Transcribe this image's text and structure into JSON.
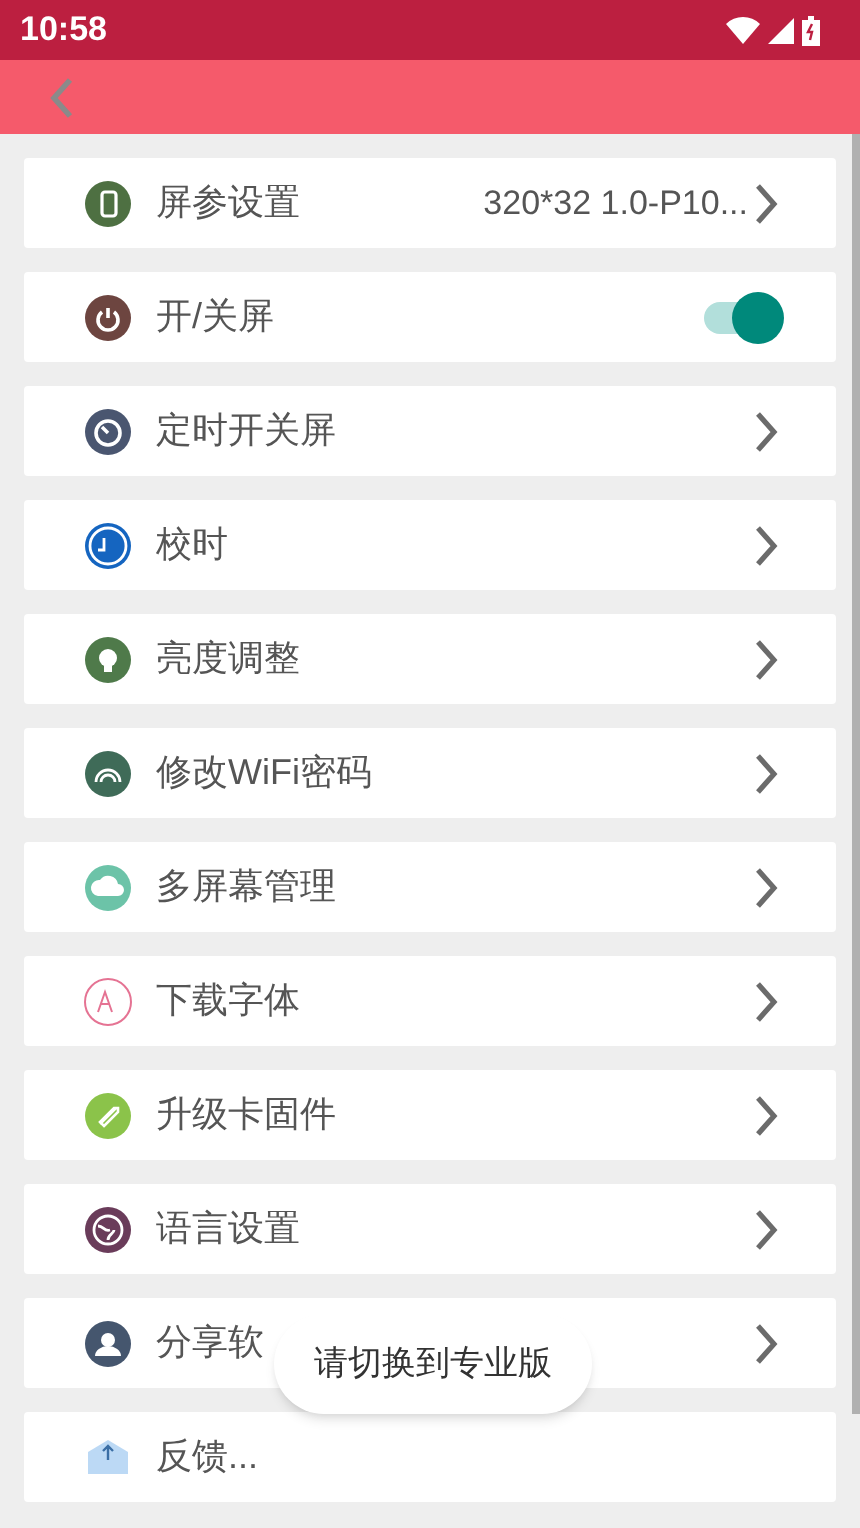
{
  "status_bar": {
    "time": "10:58"
  },
  "rows": [
    {
      "kind": "value",
      "label": "屏参设置",
      "value": "320*32 1.0-P10...",
      "color": "#4e7042"
    },
    {
      "kind": "toggle",
      "label": "开/关屏",
      "on": true,
      "color": "#6d4540"
    },
    {
      "kind": "link",
      "label": "定时开关屏",
      "color": "#4a5670"
    },
    {
      "kind": "link",
      "label": "校时",
      "color": "#1565c0"
    },
    {
      "kind": "link",
      "label": "亮度调整",
      "color": "#4f7a4a"
    },
    {
      "kind": "link",
      "label": "修改WiFi密码",
      "color": "#3f6b58"
    },
    {
      "kind": "link",
      "label": "多屏幕管理",
      "color": "#6cc3a8"
    },
    {
      "kind": "link",
      "label": "下载字体",
      "color": "#e57393"
    },
    {
      "kind": "link",
      "label": "升级卡固件",
      "color": "#8bc34a"
    },
    {
      "kind": "link",
      "label": "语言设置",
      "color": "#6a3c5a"
    },
    {
      "kind": "link",
      "label": "分享软",
      "color": "#45566e"
    },
    {
      "kind": "plain",
      "label": "反馈...",
      "color": "#bcd9f5"
    }
  ],
  "toast": {
    "text": "请切换到专业版"
  }
}
